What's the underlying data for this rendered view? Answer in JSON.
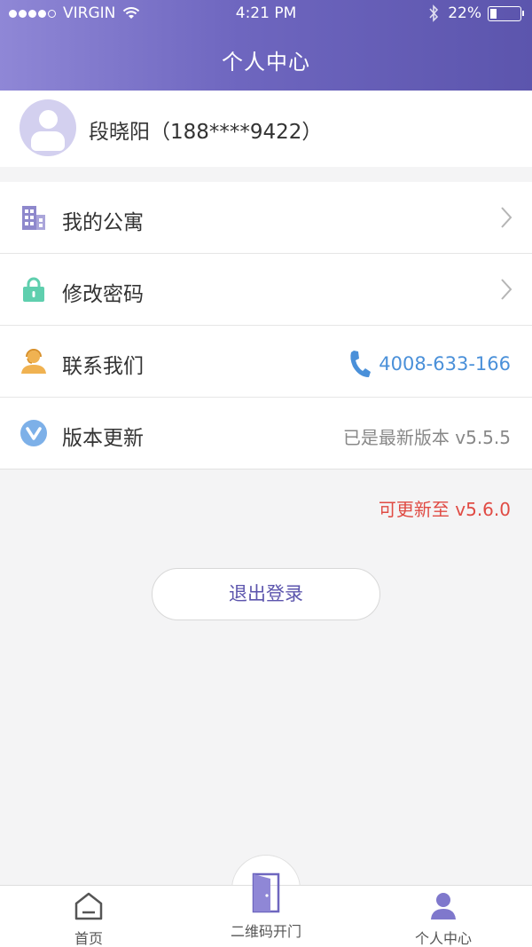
{
  "status_bar": {
    "carrier": "VIRGIN",
    "time": "4:21 PM",
    "battery": "22%",
    "battery_level": 0.22
  },
  "header": {
    "title": "个人中心"
  },
  "profile": {
    "name": "段晓阳（188****9422）"
  },
  "menu": [
    {
      "label": "我的公寓",
      "icon": "building-icon",
      "accessory": "chevron"
    },
    {
      "label": "修改密码",
      "icon": "lock-icon",
      "accessory": "chevron"
    },
    {
      "label": "联系我们",
      "icon": "customer-service-icon",
      "value": "4008-633-166"
    },
    {
      "label": "版本更新",
      "icon": "version-icon",
      "value": "已是最新版本 v5.5.5"
    }
  ],
  "update_hint": "可更新至 v5.6.0",
  "logout_label": "退出登录",
  "tabs": [
    {
      "label": "首页",
      "icon": "home-icon"
    },
    {
      "label": "二维码开门",
      "icon": "door-icon"
    },
    {
      "label": "个人中心",
      "icon": "person-icon"
    }
  ],
  "colors": {
    "accent": "#5c55ad",
    "link": "#4a90d9",
    "warning": "#e04b44"
  }
}
